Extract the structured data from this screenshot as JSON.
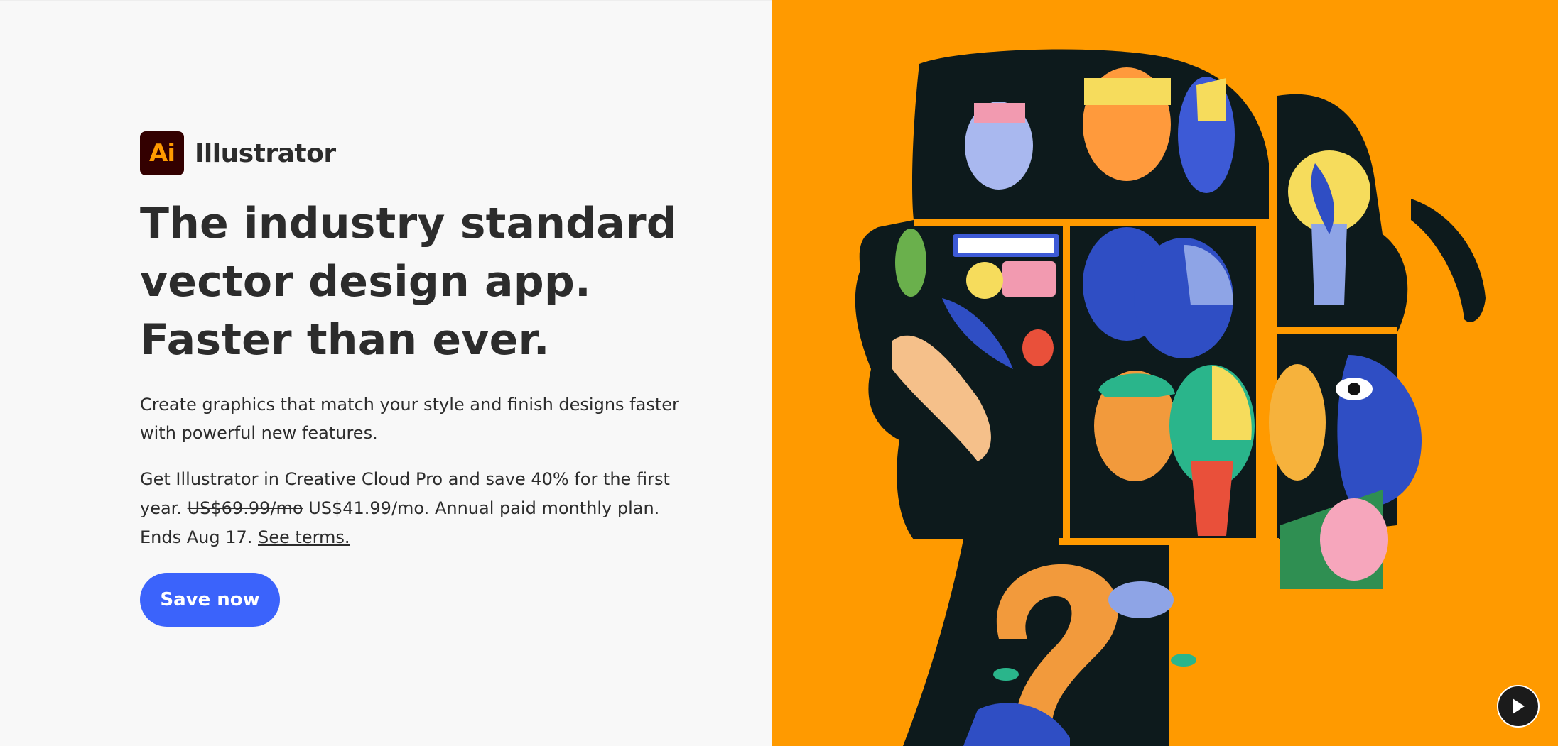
{
  "brand": {
    "logo_text": "Ai",
    "name": "Illustrator"
  },
  "hero": {
    "headline": "The industry standard vector design app. Faster than ever.",
    "description": "Create graphics that match your style and finish designs faster with powerful new features."
  },
  "offer": {
    "intro": "Get Illustrator in Creative Cloud Pro and save 40% for the first year. ",
    "old_price": "US$69.99/mo",
    "details": " US$41.99/mo. Annual paid monthly plan. Ends Aug 17. ",
    "terms_link": "See terms."
  },
  "cta": {
    "label": "Save now"
  },
  "media": {
    "play_icon": "play-icon",
    "colors": {
      "background": "#ff9a00",
      "silhouette": "#0d1a1c",
      "cta": "#3b63fb",
      "logo_bg": "#330000",
      "logo_fg": "#ff9a00"
    }
  }
}
